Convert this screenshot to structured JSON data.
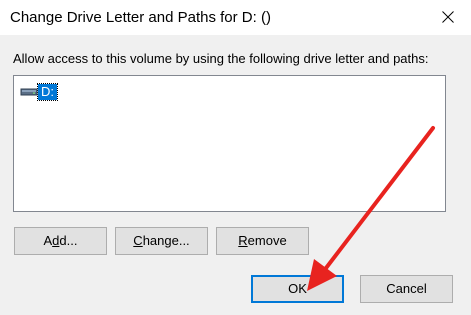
{
  "window": {
    "title": "Change Drive Letter and Paths for D: ()",
    "close_glyph": "close-icon"
  },
  "group": {
    "label": "Allow access to this volume by using the following drive letter and paths:"
  },
  "list": {
    "items": [
      {
        "label": "D:",
        "icon": "drive-icon",
        "selected": true
      }
    ]
  },
  "buttons": {
    "add": {
      "prefix": "A",
      "underlined": "d",
      "suffix": "d..."
    },
    "change": {
      "prefix": "",
      "underlined": "C",
      "suffix": "hange..."
    },
    "remove": {
      "prefix": "",
      "underlined": "R",
      "suffix": "emove"
    },
    "ok": "OK",
    "cancel": "Cancel"
  },
  "annotation": {
    "color": "#e8231f",
    "icon": "red-arrow-pointing-to-ok"
  },
  "colors": {
    "selection": "#0078d7",
    "button_face": "#e1e1e1",
    "dialog_bg": "#f0f0f0"
  }
}
